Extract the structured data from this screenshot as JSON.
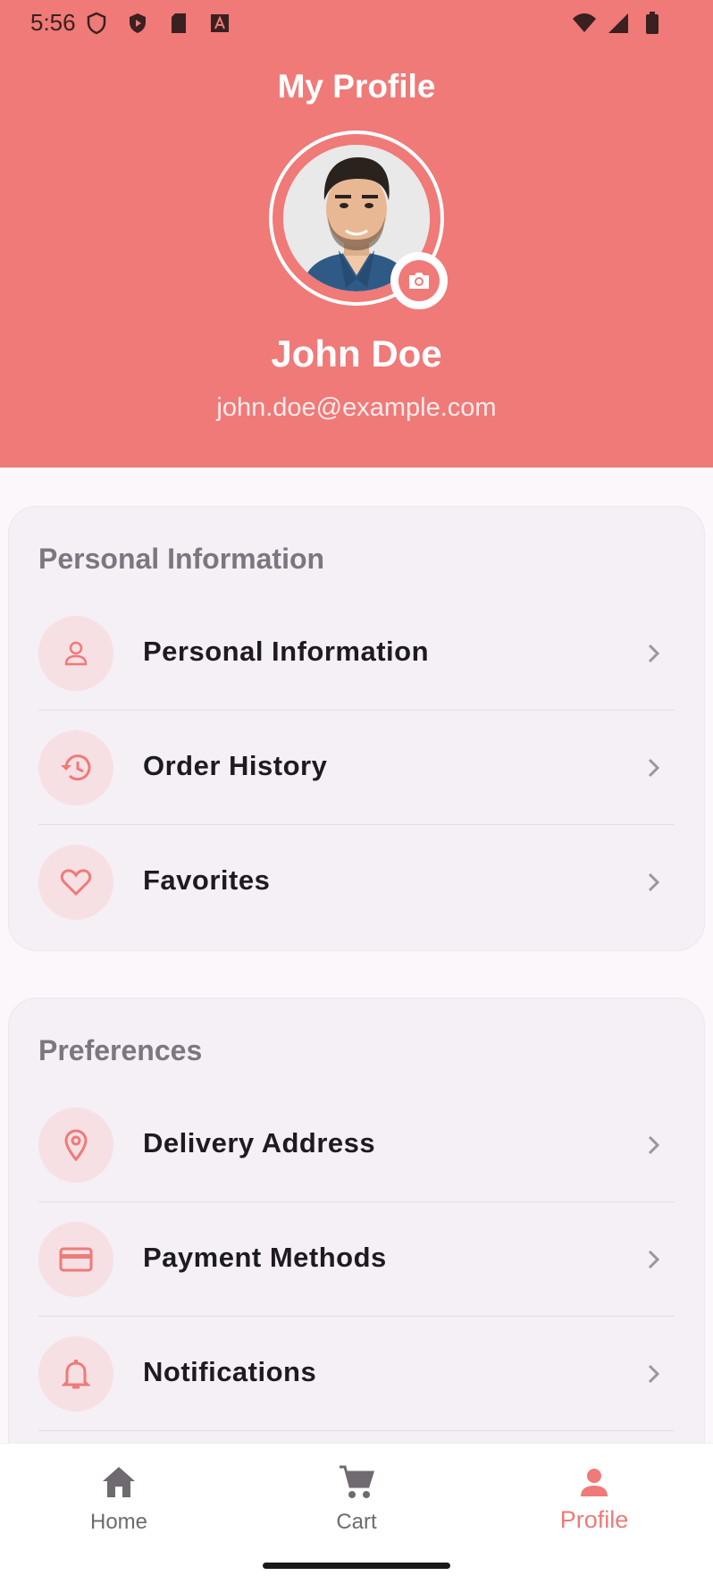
{
  "status_bar": {
    "time": "5:56"
  },
  "header": {
    "title": "My Profile",
    "user_name": "John Doe",
    "user_email": "john.doe@example.com"
  },
  "sections": [
    {
      "title": "Personal Information",
      "items": [
        {
          "label": "Personal Information",
          "icon": "person-icon"
        },
        {
          "label": "Order History",
          "icon": "history-icon"
        },
        {
          "label": "Favorites",
          "icon": "heart-icon"
        }
      ]
    },
    {
      "title": "Preferences",
      "items": [
        {
          "label": "Delivery Address",
          "icon": "location-pin-icon"
        },
        {
          "label": "Payment Methods",
          "icon": "credit-card-icon"
        },
        {
          "label": "Notifications",
          "icon": "bell-icon"
        }
      ]
    }
  ],
  "bottom_nav": [
    {
      "label": "Home",
      "icon": "home-icon",
      "active": false
    },
    {
      "label": "Cart",
      "icon": "cart-icon",
      "active": false
    },
    {
      "label": "Profile",
      "icon": "profile-icon",
      "active": true
    }
  ],
  "colors": {
    "accent": "#ef7a78",
    "card_background": "#f4f0f6",
    "icon_circle": "#f6e0e4",
    "page_background": "#fcf7fa"
  }
}
